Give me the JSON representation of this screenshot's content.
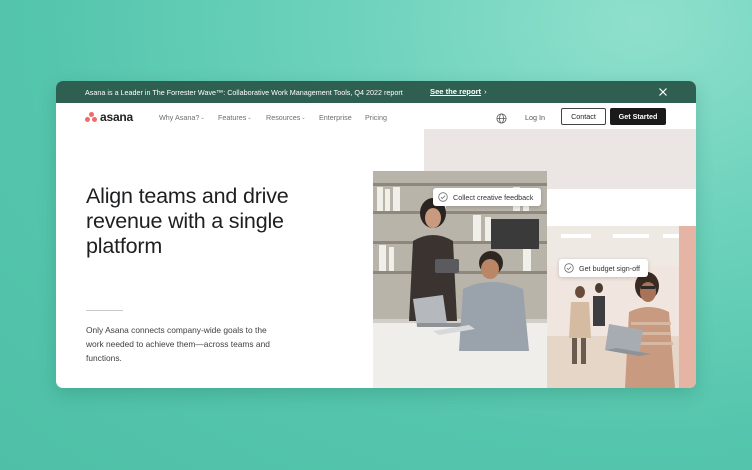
{
  "banner": {
    "text": "Asana is a Leader in The Forrester Wave™: Collaborative Work Management Tools, Q4 2022 report",
    "link_label": "See the report",
    "link_arrow": "›"
  },
  "nav": {
    "brand": "asana",
    "items": [
      {
        "label": "Why Asana?",
        "has_dropdown": true
      },
      {
        "label": "Features",
        "has_dropdown": true
      },
      {
        "label": "Resources",
        "has_dropdown": true
      },
      {
        "label": "Enterprise",
        "has_dropdown": false
      },
      {
        "label": "Pricing",
        "has_dropdown": false
      }
    ],
    "dropdown_glyph": "⌄",
    "login_label": "Log In",
    "contact_label": "Contact",
    "get_started_label": "Get Started"
  },
  "hero": {
    "title": "Align teams and drive revenue with a single platform",
    "subtitle": "Only Asana connects company-wide goals to the work needed to achieve them—across teams and functions."
  },
  "chips": {
    "feedback": "Collect creative feedback",
    "budget": "Get budget sign-off"
  },
  "colors": {
    "background": "#55c6ad",
    "banner": "#2e5f50",
    "brand": "#f06a6a",
    "primary_button": "#1a1a1a"
  },
  "icons": {
    "close": "close-icon",
    "globe": "globe-icon",
    "check": "check-circle-icon",
    "logo": "asana-logo-icon"
  }
}
